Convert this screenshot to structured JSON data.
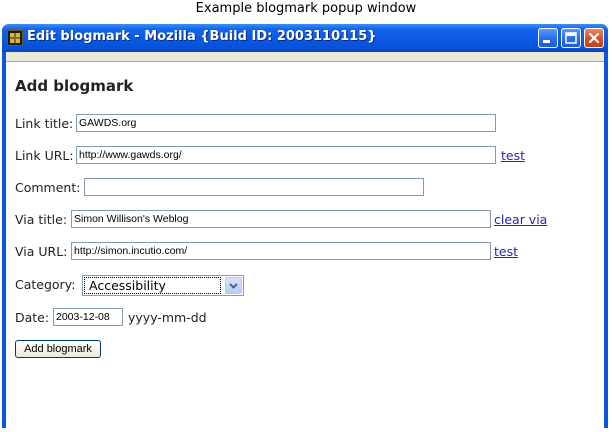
{
  "caption": "Example blogmark popup window",
  "window": {
    "title": "Edit blogmark - Mozilla {Build ID: 2003110115}",
    "menustrip_dots": "···"
  },
  "form": {
    "heading": "Add blogmark",
    "link_title": {
      "label": "Link title:",
      "value": "GAWDS.org"
    },
    "link_url": {
      "label": "Link URL:",
      "value": "http://www.gawds.org/",
      "link": "test"
    },
    "comment": {
      "label": "Comment:",
      "value": ""
    },
    "via_title": {
      "label": "Via title:",
      "value": "Simon Willison's Weblog",
      "link": "clear via"
    },
    "via_url": {
      "label": "Via URL:",
      "value": "http://simon.incutio.com/",
      "link": "test"
    },
    "category": {
      "label": "Category:",
      "selected": "Accessibility"
    },
    "date": {
      "label": "Date:",
      "value": "2003-12-08",
      "hint": "yyyy-mm-dd"
    },
    "submit_label": "Add blogmark"
  },
  "icons": {
    "app": "mozilla-app-icon",
    "minimize": "minimize-icon",
    "maximize": "maximize-icon",
    "close": "close-icon",
    "dropdown": "chevron-down-icon"
  },
  "colors": {
    "titlebar": "#0a58e4",
    "link": "#2a25b6",
    "close_button": "#d9532a"
  }
}
